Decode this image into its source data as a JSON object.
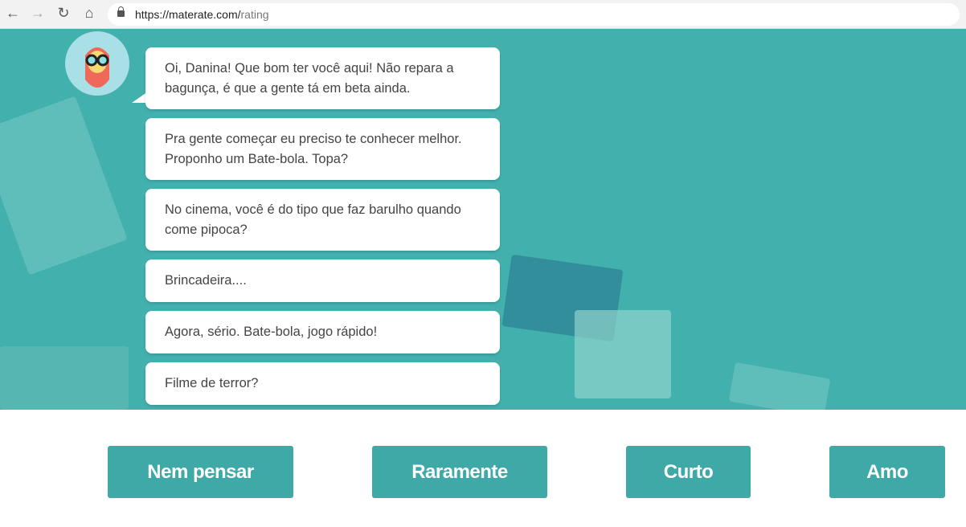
{
  "browser": {
    "url_host": "https://materate.com/",
    "url_path": "rating"
  },
  "chat": {
    "messages": [
      "Oi, Danina! Que bom ter você aqui! Não repara a bagunça, é que a gente tá em beta ainda.",
      "Pra gente começar eu preciso te conhecer melhor. Proponho um Bate-bola. Topa?",
      "No cinema, você é do tipo que faz barulho quando come pipoca?",
      "Brincadeira....",
      "Agora, sério. Bate-bola, jogo rápido!",
      "Filme de terror?"
    ]
  },
  "answers": [
    "Nem pensar",
    "Raramente",
    "Curto",
    "Amo"
  ],
  "colors": {
    "teal": "#42b1ae",
    "button": "#3fa9a8"
  }
}
